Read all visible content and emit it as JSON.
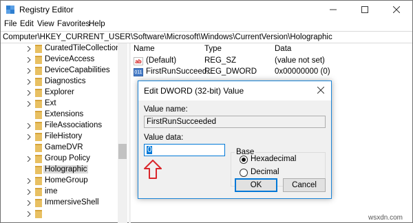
{
  "window": {
    "title": "Registry Editor",
    "menus": [
      "File",
      "Edit",
      "View",
      "Favorites",
      "Help"
    ],
    "address": "Computer\\HKEY_CURRENT_USER\\Software\\Microsoft\\Windows\\CurrentVersion\\Holographic"
  },
  "tree": {
    "items": [
      {
        "label": "CuratedTileCollections"
      },
      {
        "label": "DeviceAccess"
      },
      {
        "label": "DeviceCapabilities"
      },
      {
        "label": "Diagnostics"
      },
      {
        "label": "Explorer"
      },
      {
        "label": "Ext"
      },
      {
        "label": "Extensions"
      },
      {
        "label": "FileAssociations"
      },
      {
        "label": "FileHistory"
      },
      {
        "label": "GameDVR"
      },
      {
        "label": "Group Policy"
      },
      {
        "label": "Holographic",
        "selected": true
      },
      {
        "label": "HomeGroup"
      },
      {
        "label": "ime"
      },
      {
        "label": "ImmersiveShell"
      }
    ]
  },
  "list": {
    "headers": {
      "name": "Name",
      "type": "Type",
      "data": "Data"
    },
    "rows": [
      {
        "icon": "string-value-icon",
        "name": "(Default)",
        "type": "REG_SZ",
        "data": "(value not set)"
      },
      {
        "icon": "binary-value-icon",
        "name": "FirstRunSucceed...",
        "type": "REG_DWORD",
        "data": "0x00000000 (0)"
      }
    ]
  },
  "dialog": {
    "title": "Edit DWORD (32-bit) Value",
    "value_name_label": "Value name:",
    "value_name": "FirstRunSucceeded",
    "value_data_label": "Value data:",
    "value_data": "0",
    "base_label": "Base",
    "base_options": [
      {
        "label": "Hexadecimal",
        "checked": true
      },
      {
        "label": "Decimal",
        "checked": false
      }
    ],
    "ok_label": "OK",
    "cancel_label": "Cancel"
  },
  "watermark": "wsxdn.com",
  "colors": {
    "accent": "#0078d7",
    "folder": "#e8c062",
    "arrow": "#d9262b"
  }
}
